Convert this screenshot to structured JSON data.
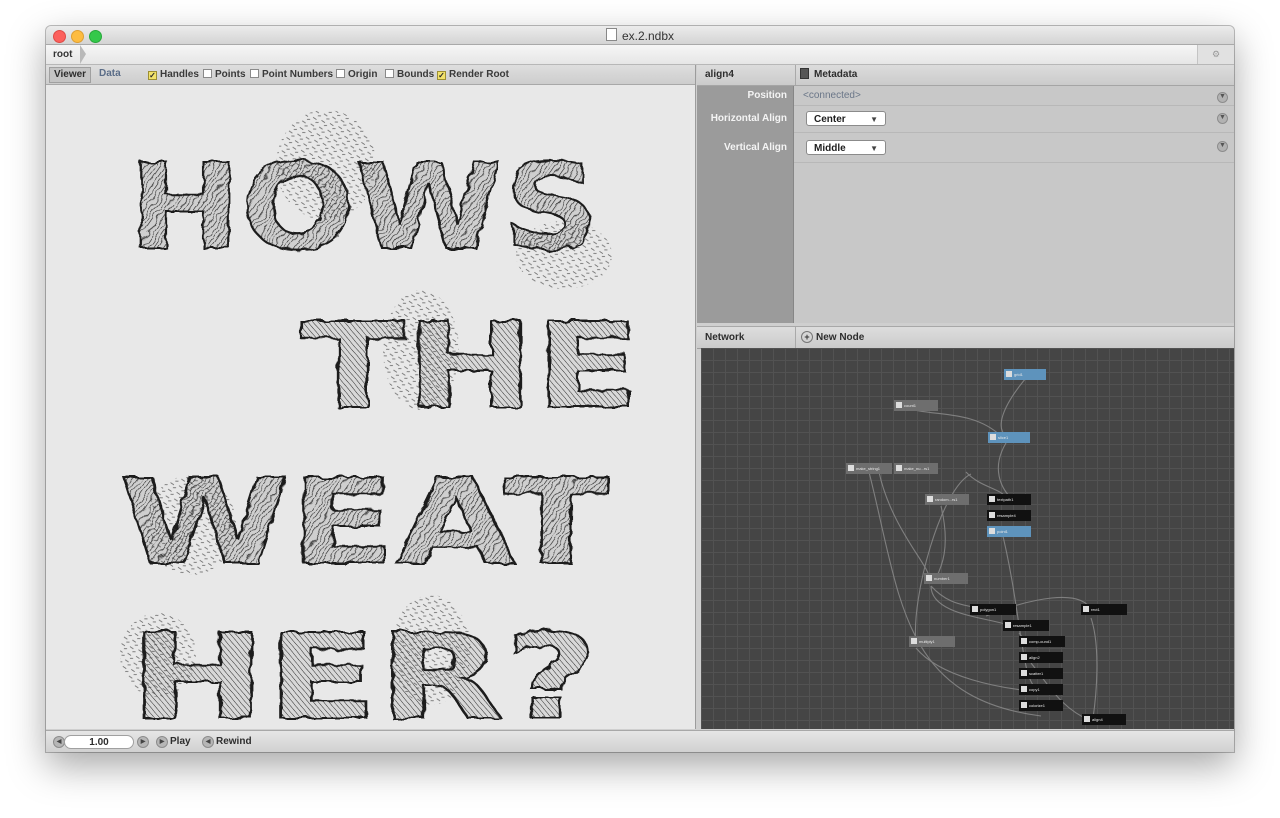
{
  "window": {
    "title": "ex.2.ndbx"
  },
  "breadcrumb": {
    "items": [
      "root"
    ]
  },
  "viewer": {
    "tabs": {
      "viewer": "Viewer",
      "data": "Data"
    },
    "options": [
      {
        "label": "Handles",
        "checked": true
      },
      {
        "label": "Points",
        "checked": false
      },
      {
        "label": "Point Numbers",
        "checked": false
      },
      {
        "label": "Origin",
        "checked": false
      },
      {
        "label": "Bounds",
        "checked": false
      },
      {
        "label": "Render Root",
        "checked": true
      }
    ],
    "canvas_text": {
      "line1": "HOWS",
      "line2": "THE",
      "line3": "WEAT",
      "line4": "HER?"
    }
  },
  "params": {
    "node_name": "align4",
    "metadata_label": "Metadata",
    "fields": [
      {
        "label": "Position",
        "value": "<connected>"
      },
      {
        "label": "Horizontal Align",
        "value": "Center"
      },
      {
        "label": "Vertical Align",
        "value": "Middle"
      }
    ]
  },
  "network": {
    "title": "Network",
    "new_node_label": "New Node",
    "nodes": [
      {
        "label": "grid1",
        "style": "blue"
      },
      {
        "label": "count1",
        "style": "gray"
      },
      {
        "label": "slice1",
        "style": "blue"
      },
      {
        "label": "make_string1",
        "style": "gray"
      },
      {
        "label": "make_nu...rs1",
        "style": "gray"
      },
      {
        "label": "random...rs1",
        "style": "gray"
      },
      {
        "label": "textpath1",
        "style": "black"
      },
      {
        "label": "resample4",
        "style": "black"
      },
      {
        "label": "point1",
        "style": "blue"
      },
      {
        "label": "number1",
        "style": "gray"
      },
      {
        "label": "polygon1",
        "style": "black"
      },
      {
        "label": "rect1",
        "style": "black"
      },
      {
        "label": "resample1",
        "style": "black"
      },
      {
        "label": "multiply1",
        "style": "gray"
      },
      {
        "label": "comp-ound1",
        "style": "black"
      },
      {
        "label": "align2",
        "style": "black"
      },
      {
        "label": "scatter1",
        "style": "black"
      },
      {
        "label": "copy1",
        "style": "black"
      },
      {
        "label": "colorize1",
        "style": "black"
      },
      {
        "label": "align4",
        "style": "black"
      }
    ]
  },
  "bottom": {
    "frame": "1.00",
    "play": "Play",
    "rewind": "Rewind"
  },
  "colors": {
    "viewer_bg": "#e8e8e8",
    "network_bg": "#454545",
    "node_blue": "#5e93bc",
    "checkbox_yellow": "#f2e26a"
  }
}
